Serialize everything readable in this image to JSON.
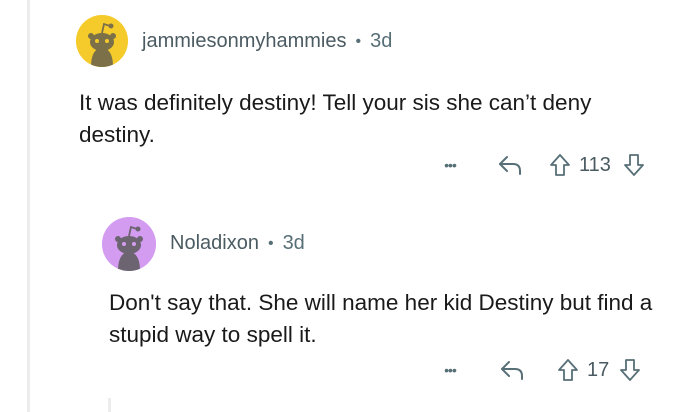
{
  "comments": [
    {
      "username": "jammiesonmyhammies",
      "separator": "•",
      "age": "3d",
      "avatar_color": "#f5cb2b",
      "body": "It was definitely destiny! Tell your sis she can’t deny destiny.",
      "more_label": "•••",
      "reply_icon": "reply-arrow",
      "upvotes": "113"
    },
    {
      "username": "Noladixon",
      "separator": "•",
      "age": "3d",
      "avatar_color": "#d49cf1",
      "body": "Don't say that. She will name her kid Destiny but find a stupid way to spell it.",
      "more_label": "•••",
      "reply_icon": "reply-arrow",
      "upvotes": "17"
    }
  ],
  "colors": {
    "thread_line": "#ececec",
    "meta_text": "#576f76",
    "body_text": "#1a1a1b"
  }
}
